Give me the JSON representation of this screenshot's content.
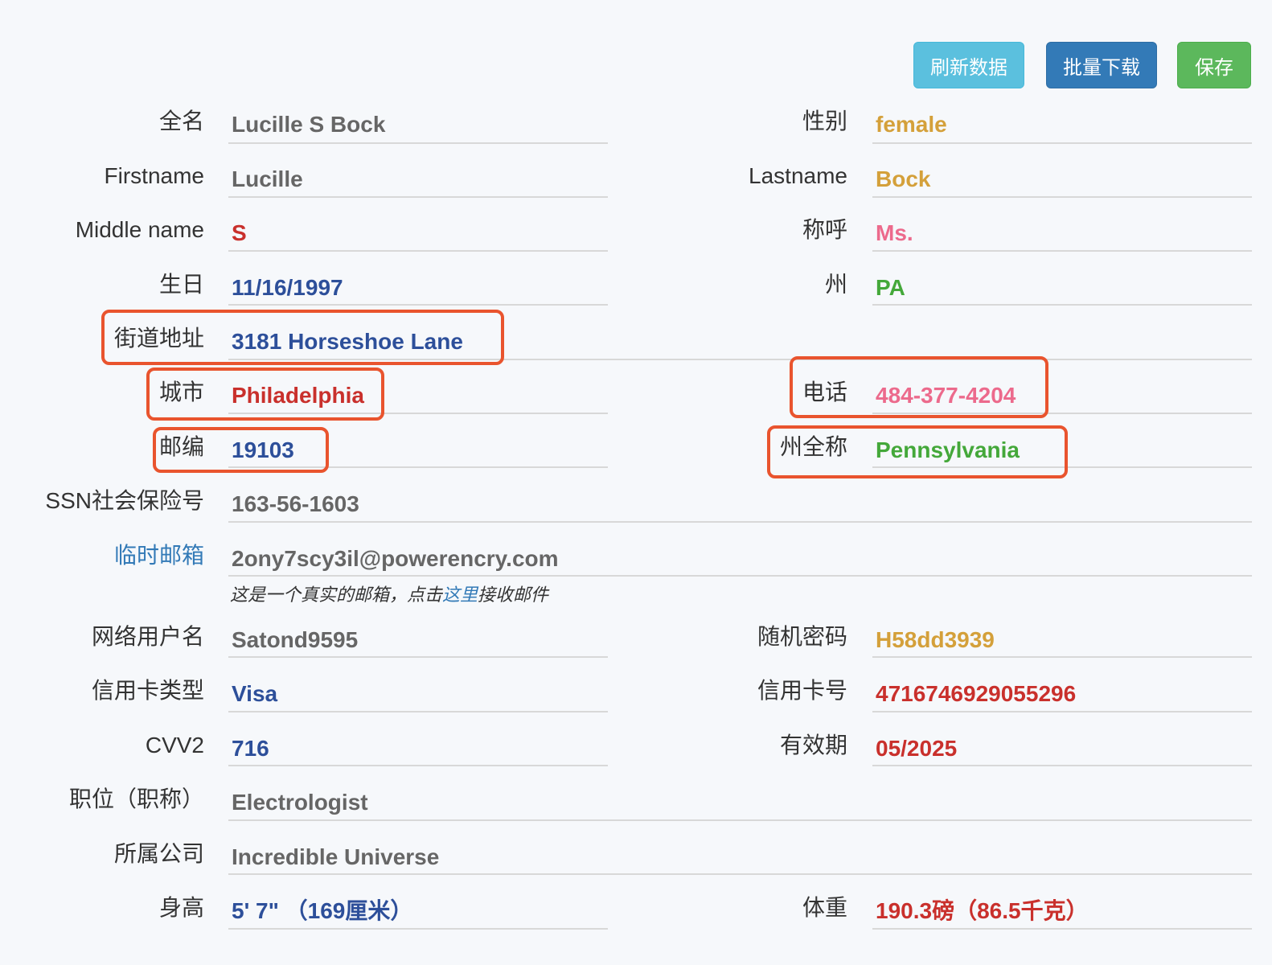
{
  "toolbar": {
    "refresh_label": "刷新数据",
    "batch_download_label": "批量下载",
    "save_label": "保存"
  },
  "fields": {
    "full_name": {
      "label": "全名",
      "value": "Lucille S Bock"
    },
    "gender": {
      "label": "性别",
      "value": "female"
    },
    "first_name": {
      "label": "Firstname",
      "value": "Lucille"
    },
    "last_name": {
      "label": "Lastname",
      "value": "Bock"
    },
    "middle_name": {
      "label": "Middle name",
      "value": "S"
    },
    "title": {
      "label": "称呼",
      "value": "Ms."
    },
    "birthday": {
      "label": "生日",
      "value": "11/16/1997"
    },
    "state": {
      "label": "州",
      "value": "PA"
    },
    "street": {
      "label": "街道地址",
      "value": "3181 Horseshoe Lane"
    },
    "city": {
      "label": "城市",
      "value": "Philadelphia"
    },
    "phone": {
      "label": "电话",
      "value": "484-377-4204"
    },
    "zip": {
      "label": "邮编",
      "value": "19103"
    },
    "state_full": {
      "label": "州全称",
      "value": "Pennsylvania"
    },
    "ssn": {
      "label": "SSN社会保险号",
      "value": "163-56-1603"
    },
    "temp_email": {
      "label": "临时邮箱",
      "value": "2ony7scy3il@powerencry.com"
    },
    "username": {
      "label": "网络用户名",
      "value": "Satond9595"
    },
    "password": {
      "label": "随机密码",
      "value": "H58dd3939"
    },
    "card_type": {
      "label": "信用卡类型",
      "value": "Visa"
    },
    "card_number": {
      "label": "信用卡号",
      "value": "4716746929055296"
    },
    "cvv2": {
      "label": "CVV2",
      "value": "716"
    },
    "expiry": {
      "label": "有效期",
      "value": "05/2025"
    },
    "job": {
      "label": "职位（职称）",
      "value": "Electrologist"
    },
    "company": {
      "label": "所属公司",
      "value": "Incredible Universe"
    },
    "height": {
      "label": "身高",
      "value": "5' 7\" （169厘米）"
    },
    "weight": {
      "label": "体重",
      "value": "190.3磅（86.5千克）"
    }
  },
  "email_note": {
    "before": "这是一个真实的邮箱，点击",
    "link": "这里",
    "after": "接收邮件"
  },
  "colors": {
    "annotation_box": "#e9542e",
    "gray_value": "#666666",
    "blue_value": "#2d4f9a",
    "red_value": "#c9302c",
    "orange_value": "#d4a03a",
    "pink_value": "#ec6a8c",
    "green_value": "#44a83a",
    "link": "#337ab7"
  }
}
